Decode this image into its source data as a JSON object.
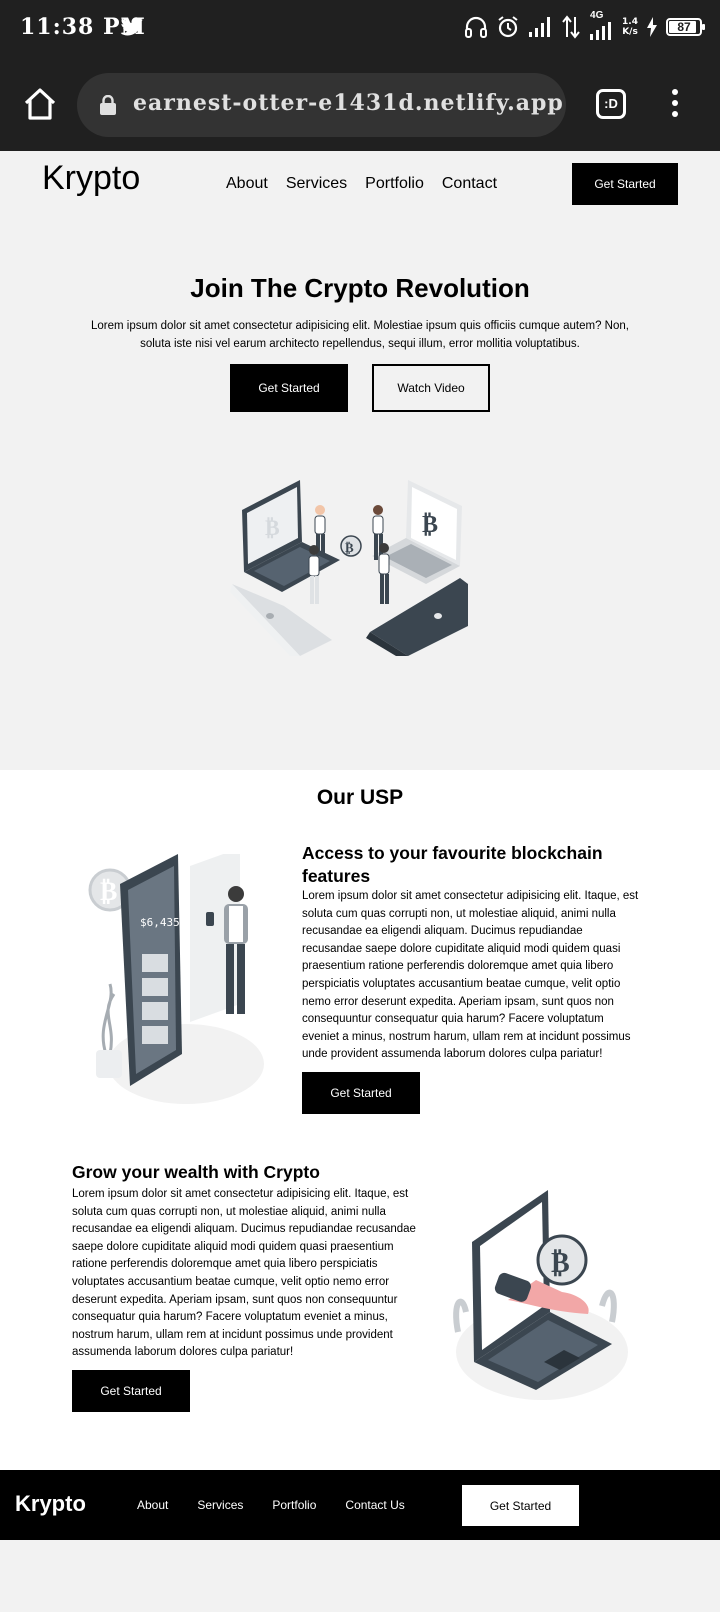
{
  "status_bar": {
    "time": "11:38 PM",
    "network": "4G",
    "speed_value": "1.4",
    "speed_unit": "K/s",
    "battery": "87"
  },
  "browser": {
    "url": "earnest-otter-e1431d.netlify.app",
    "tab_label": ":D"
  },
  "nav": {
    "logo": "Krypto",
    "links": [
      "About",
      "Services",
      "Portfolio",
      "Contact"
    ],
    "cta": "Get Started"
  },
  "hero": {
    "title": "Join The Crypto Revolution",
    "text": "Lorem ipsum dolor sit amet consectetur adipisicing elit. Molestiae ipsum quis officiis cumque autem? Non, soluta iste nisi vel earum architecto repellendus, sequi illum, error mollitia voluptatibus.",
    "primary_button": "Get Started",
    "secondary_button": "Watch Video"
  },
  "usp": {
    "title": "Our USP",
    "features": [
      {
        "title": "Access to your favourite blockchain features",
        "text": "Lorem ipsum dolor sit amet consectetur adipisicing elit. Itaque, est soluta cum quas corrupti non, ut molestiae aliquid, animi nulla recusandae ea eligendi aliquam. Ducimus repudiandae recusandae saepe dolore cupiditate aliquid modi quidem quasi praesentium ratione perferendis doloremque amet quia libero perspiciatis voluptates accusantium beatae cumque, velit optio nemo error deserunt expedita. Aperiam ipsam, sunt quos non consequuntur consequatur quia harum? Facere voluptatum eveniet a minus, nostrum harum, ullam rem at incidunt possimus unde provident assumenda laborum dolores culpa pariatur!",
        "button": "Get Started"
      },
      {
        "title": "Grow your wealth with Crypto",
        "text": "Lorem ipsum dolor sit amet consectetur adipisicing elit. Itaque, est soluta cum quas corrupti non, ut molestiae aliquid, animi nulla recusandae ea eligendi aliquam. Ducimus repudiandae recusandae saepe dolore cupiditate aliquid modi quidem quasi praesentium ratione perferendis doloremque amet quia libero perspiciatis voluptates accusantium beatae cumque, velit optio nemo error deserunt expedita. Aperiam ipsam, sunt quos non consequuntur consequatur quia harum? Facere voluptatum eveniet a minus, nostrum harum, ullam rem at incidunt possimus unde provident assumenda laborum dolores culpa pariatur!",
        "button": "Get Started"
      }
    ],
    "phone_balance": "$6,435"
  },
  "footer": {
    "logo": "Krypto",
    "links": [
      "About",
      "Services",
      "Portfolio",
      "Contact Us"
    ],
    "cta": "Get Started"
  },
  "icons": [
    "twitter-icon",
    "headphones-icon",
    "alarm-icon",
    "signal-icon",
    "data-arrows-icon",
    "battery-icon",
    "home-icon",
    "lock-icon",
    "tab-switcher-icon",
    "more-menu-icon",
    "bitcoin-icon"
  ],
  "colors": {
    "status_bg": "#202020",
    "page_bg": "#f2f2f2",
    "accent": "#000000",
    "illustration_slate": "#3b4650",
    "illustration_pink": "#f2a7a7"
  }
}
